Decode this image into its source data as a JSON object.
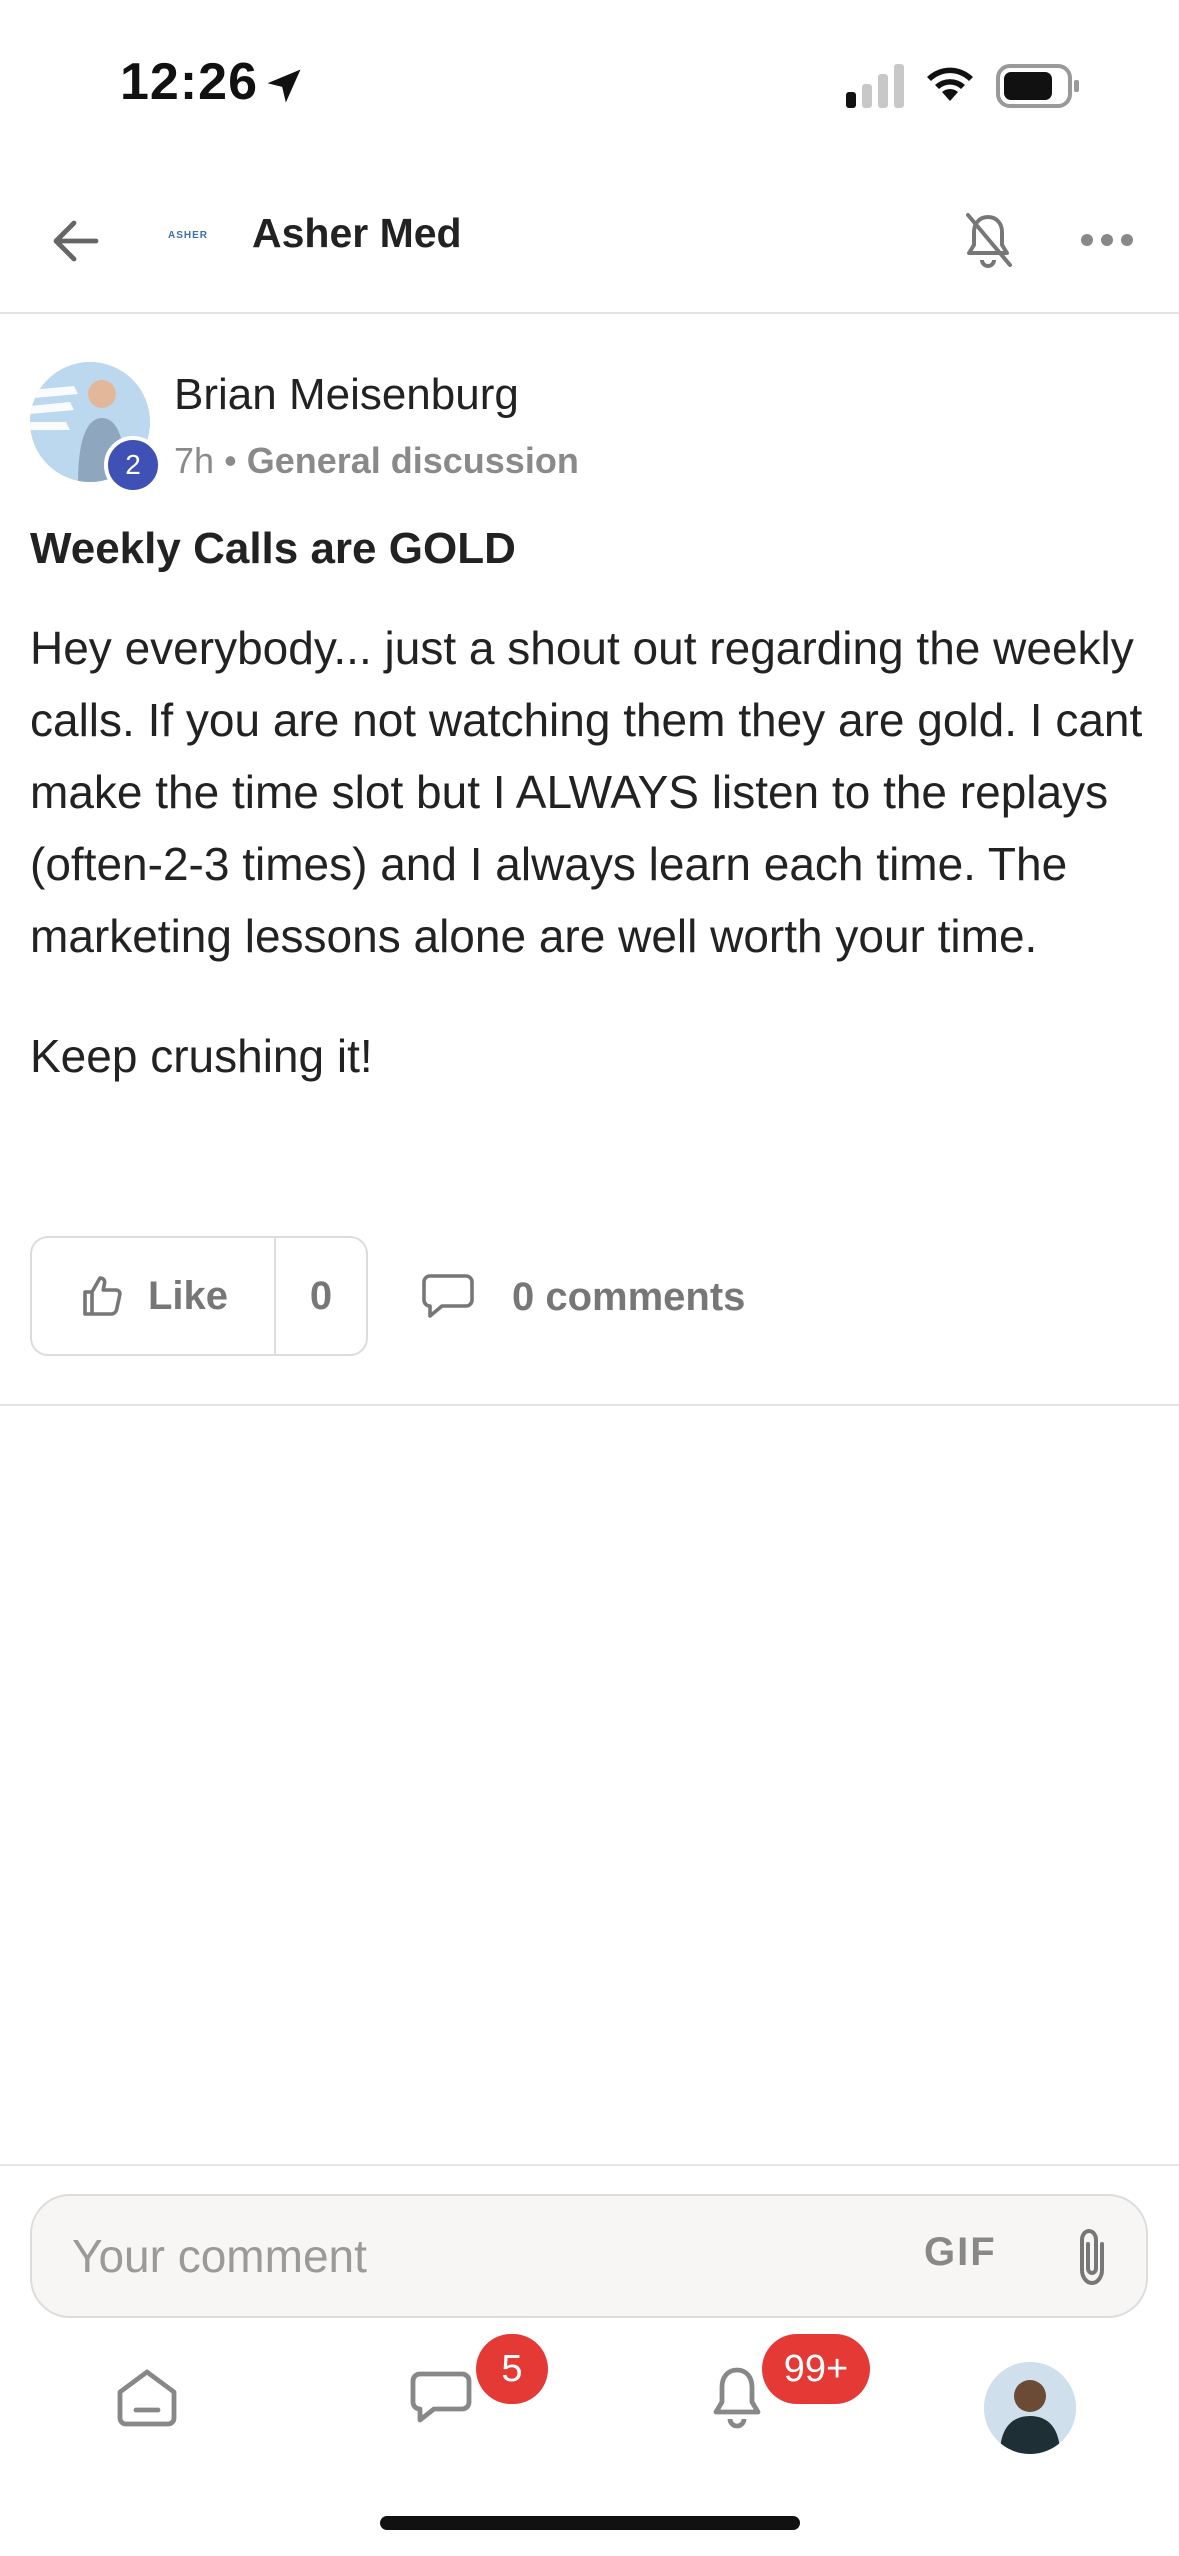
{
  "status_bar": {
    "time": "12:26"
  },
  "header": {
    "logo_text": "ASHER",
    "title": "Asher Med"
  },
  "post": {
    "author": "Brian Meisenburg",
    "level": "2",
    "time_ago": "7h",
    "separator": "•",
    "category": "General discussion",
    "title": "Weekly Calls are GOLD",
    "body": [
      "Hey everybody... just a shout out regarding the weekly calls. If you are not watching them they are gold. I cant make the time slot but I ALWAYS listen to the replays (often-2-3 times) and I always learn each time. The marketing lessons alone are well worth your time.",
      "Keep crushing it!"
    ],
    "like_label": "Like",
    "like_count": "0",
    "comments_label": "0 comments"
  },
  "comment_bar": {
    "placeholder": "Your comment",
    "gif_label": "GIF"
  },
  "bottom_nav": {
    "chat_badge": "5",
    "notifications_badge": "99+"
  },
  "colors": {
    "badge_red": "#e53935",
    "level_blue": "#3f51b5",
    "muted_text": "#777777"
  }
}
